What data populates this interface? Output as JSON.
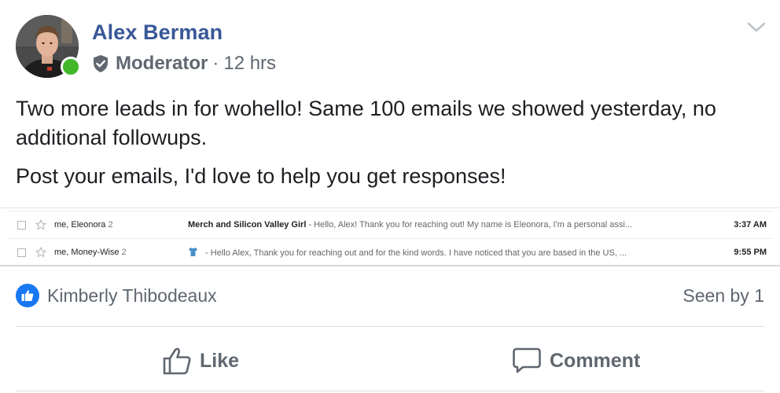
{
  "post": {
    "author": "Alex Berman",
    "role": "Moderator",
    "separator": "·",
    "time": "12 hrs",
    "paragraphs": [
      "Two more leads in for wohello! Same 100 emails we showed yesterday, no additional followups.",
      "Post your emails, I'd love to help you get responses!"
    ]
  },
  "emails": [
    {
      "sender": "me, Eleonora",
      "count": "2",
      "subject": "Merch and Silicon Valley Girl",
      "snippet": " - Hello, Alex! Thank you for reaching out! My name is Eleonora, I'm a personal assi...",
      "time": "3:37 AM"
    },
    {
      "sender": "me, Money-Wise",
      "count": "2",
      "subject": "",
      "snippet": " - Hello Alex, Thank you for reaching out and for the kind words. I have noticed that you are based in the US, ...",
      "time": "9:55 PM"
    }
  ],
  "reactions": {
    "reactor": "Kimberly Thibodeaux",
    "seen": "Seen by 1"
  },
  "actions": {
    "like": "Like",
    "comment": "Comment"
  },
  "colors": {
    "author": "#385898",
    "secondary": "#606770",
    "online": "#42b72a",
    "like_badge": "#1877f2"
  }
}
